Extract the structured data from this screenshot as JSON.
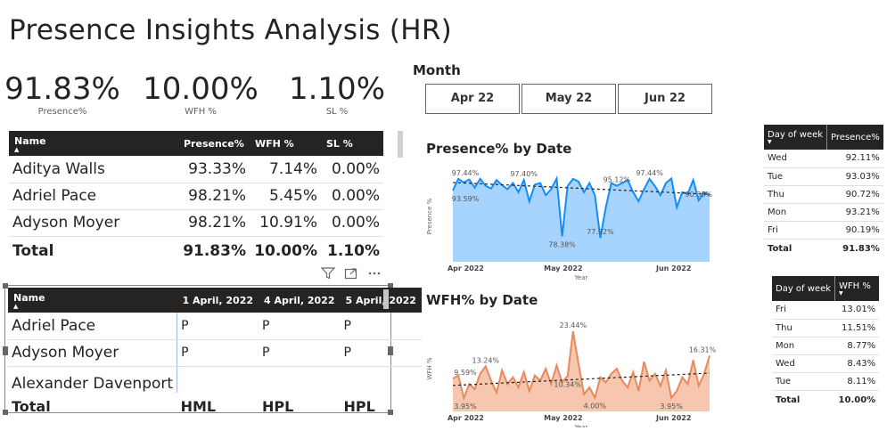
{
  "title": "Presence Insights Analysis (HR)",
  "kpis": [
    {
      "value": "91.83%",
      "label": "Presence%"
    },
    {
      "value": "10.00%",
      "label": "WFH %"
    },
    {
      "value": "1.10%",
      "label": "SL %"
    }
  ],
  "summary_table": {
    "headers": [
      "Name",
      "Presence%",
      "WFH %",
      "SL %"
    ],
    "rows": [
      [
        "Aditya Walls",
        "93.33%",
        "7.14%",
        "0.00%"
      ],
      [
        "Adriel Pace",
        "98.21%",
        "5.45%",
        "0.00%"
      ],
      [
        "Adyson Moyer",
        "98.21%",
        "10.91%",
        "0.00%"
      ]
    ],
    "total": [
      "Total",
      "91.83%",
      "10.00%",
      "1.10%"
    ]
  },
  "matrix_table": {
    "headers": [
      "Name",
      "1 April, 2022",
      "4 April, 2022",
      "5 April, 2022"
    ],
    "rows": [
      [
        "Adriel Pace",
        "P",
        "P",
        "P"
      ],
      [
        "Adyson Moyer",
        "P",
        "P",
        "P"
      ],
      [
        "Alexander Davenport",
        "",
        "",
        ""
      ]
    ],
    "total": [
      "Total",
      "HML",
      "HPL",
      "HPL"
    ]
  },
  "slicer": {
    "title": "Month",
    "options": [
      "Apr 22",
      "May 22",
      "Jun 22"
    ]
  },
  "presence_by_dow": {
    "headers": [
      "Day of week",
      "Presence%"
    ],
    "rows": [
      [
        "Wed",
        "92.11%"
      ],
      [
        "Tue",
        "93.03%"
      ],
      [
        "Thu",
        "90.72%"
      ],
      [
        "Mon",
        "93.21%"
      ],
      [
        "Fri",
        "90.19%"
      ]
    ],
    "total": [
      "Total",
      "91.83%"
    ]
  },
  "wfh_by_dow": {
    "headers": [
      "Day of week",
      "WFH %"
    ],
    "rows": [
      [
        "Fri",
        "13.01%"
      ],
      [
        "Thu",
        "11.51%"
      ],
      [
        "Mon",
        "8.77%"
      ],
      [
        "Wed",
        "8.43%"
      ],
      [
        "Tue",
        "8.11%"
      ]
    ],
    "total": [
      "Total",
      "10.00%"
    ]
  },
  "colors": {
    "presence_line": "#118dff",
    "presence_fill": "#a7d3ff",
    "wfh_line": "#e8895e",
    "wfh_fill": "#f6c6ae",
    "header_dark": "#252423"
  },
  "chart_data": [
    {
      "type": "area",
      "title": "Presence% by Date",
      "xlabel": "Year",
      "ylabel": "Presence %",
      "x_ticks": [
        "Apr 2022",
        "May 2022",
        "Jun 2022"
      ],
      "ylim": [
        70,
        100
      ],
      "values": [
        93.6,
        97.4,
        96.2,
        97.2,
        94.5,
        97.4,
        95.1,
        94.2,
        97.0,
        95.3,
        94.0,
        96.0,
        93.0,
        97.0,
        90.0,
        95.5,
        96.0,
        92.0,
        94.0,
        97.5,
        78.4,
        95.0,
        97.4,
        96.5,
        93.0,
        96.0,
        92.0,
        77.9,
        88.0,
        96.0,
        95.1,
        96.0,
        97.0,
        93.0,
        90.0,
        94.0,
        97.4,
        95.0,
        92.0,
        96.0,
        97.5,
        88.0,
        93.0,
        92.5,
        97.0,
        90.3,
        93.0,
        92.0
      ],
      "annotations": [
        {
          "label": "97.44%",
          "i": 1,
          "pos": "above"
        },
        {
          "label": "93.59%",
          "i": 0,
          "pos": "below"
        },
        {
          "label": "97.40%",
          "i": 13,
          "pos": "above"
        },
        {
          "label": "78.38%",
          "i": 20,
          "pos": "below"
        },
        {
          "label": "77.92%",
          "i": 27,
          "pos": "above"
        },
        {
          "label": "95.12%",
          "i": 30,
          "pos": "above"
        },
        {
          "label": "97.44%",
          "i": 36,
          "pos": "above"
        },
        {
          "label": "90.38%",
          "i": 45,
          "pos": "above"
        }
      ],
      "trend": [
        96.2,
        92.3
      ]
    },
    {
      "type": "area",
      "title": "WFH% by Date",
      "xlabel": "Year",
      "ylabel": "WFH %",
      "x_ticks": [
        "Apr 2022",
        "May 2022",
        "Jun 2022"
      ],
      "ylim": [
        0,
        25
      ],
      "values": [
        9.6,
        10.5,
        3.95,
        8.0,
        6.5,
        11.0,
        13.2,
        9.0,
        5.5,
        12.0,
        8.0,
        10.0,
        7.0,
        11.5,
        6.0,
        10.5,
        9.0,
        12.5,
        8.0,
        13.5,
        8.5,
        10.34,
        23.4,
        14.0,
        5.0,
        7.0,
        4.0,
        10.0,
        8.5,
        11.0,
        12.5,
        9.0,
        7.0,
        11.5,
        6.0,
        14.5,
        9.0,
        11.0,
        7.5,
        12.0,
        3.95,
        6.0,
        10.0,
        8.0,
        15.0,
        7.5,
        11.0,
        16.31
      ],
      "annotations": [
        {
          "label": "9.59%",
          "i": 0,
          "pos": "above"
        },
        {
          "label": "3.95%",
          "i": 2,
          "pos": "below"
        },
        {
          "label": "13.24%",
          "i": 6,
          "pos": "above"
        },
        {
          "label": "10.34%",
          "i": 21,
          "pos": "below"
        },
        {
          "label": "23.44%",
          "i": 22,
          "pos": "above"
        },
        {
          "label": "4.00%",
          "i": 26,
          "pos": "below"
        },
        {
          "label": "3.95%",
          "i": 40,
          "pos": "below"
        },
        {
          "label": "16.31%",
          "i": 47,
          "pos": "above"
        }
      ],
      "trend": [
        7.6,
        11.2
      ]
    }
  ]
}
